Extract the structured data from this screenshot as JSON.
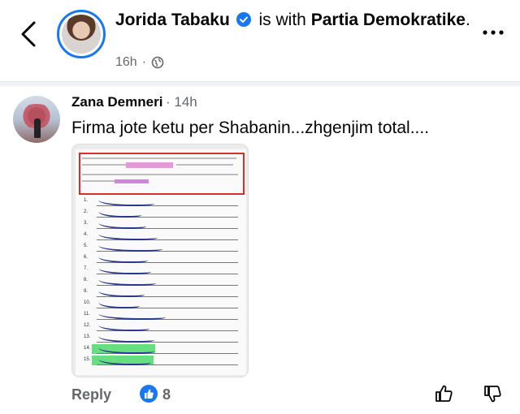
{
  "post": {
    "author": "Jorida Tabaku",
    "connector": "is with",
    "with_page": "Partia Demokratike",
    "period": ".",
    "time": "16h",
    "separator": "·",
    "audience_icon": "globe-icon"
  },
  "comment": {
    "author": "Zana Demneri",
    "time": "· 14h",
    "text": "Firma jote ketu per Shabanin...zhgenjim total....",
    "reply_label": "Reply",
    "like_count": "8"
  },
  "colors": {
    "accent": "#1877f2",
    "secondary_text": "#65676b",
    "highlight_red": "#d93025",
    "highlight_pink": "#e39bd8",
    "highlight_green": "#4cd86a"
  }
}
